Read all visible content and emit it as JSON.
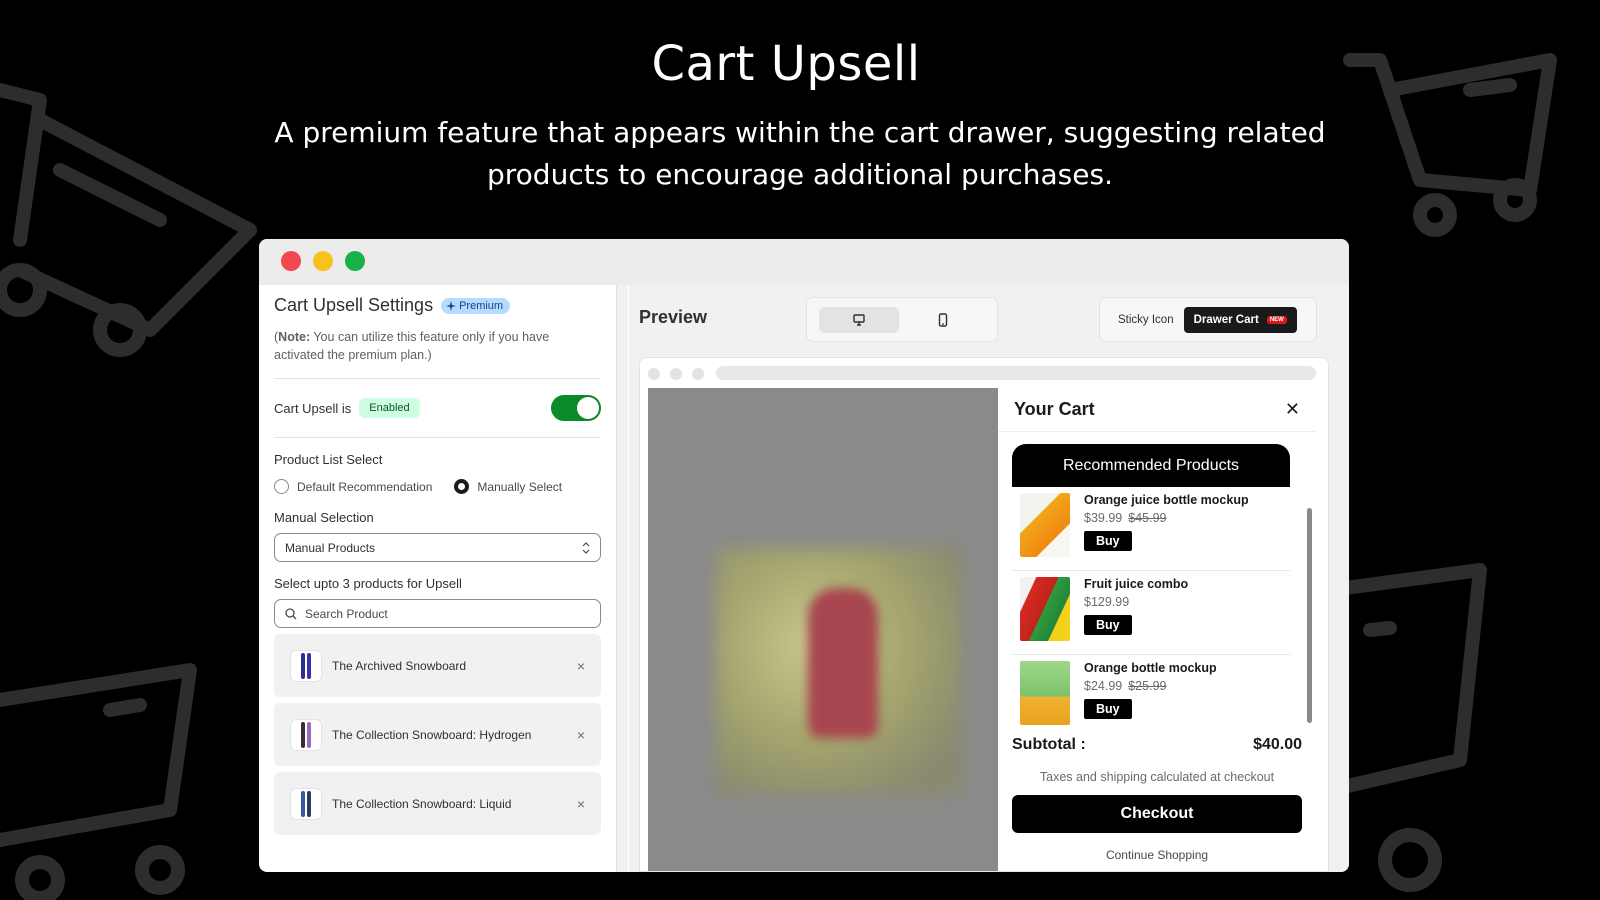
{
  "hero": {
    "title": "Cart Upsell",
    "subtitle": "A premium feature that appears within the cart drawer, suggesting related products to encourage additional purchases."
  },
  "settings": {
    "title": "Cart Upsell Settings",
    "premium_badge": "Premium",
    "note_bold": "Note:",
    "note_open": "(",
    "note_text": " You can utilize this feature only if you have activated the premium plan.)",
    "status_label": "Cart Upsell is",
    "status_badge": "Enabled",
    "toggle_on": true,
    "product_list_label": "Product List Select",
    "radio_default": "Default Recommendation",
    "radio_manual": "Manually Select",
    "manual_selection_label": "Manual Selection",
    "manual_select_value": "Manual Products",
    "upsell_label": "Select upto 3 products for Upsell",
    "search_placeholder": "Search Product",
    "products": [
      {
        "name": "The Archived Snowboard",
        "remove": "×"
      },
      {
        "name": "The Collection Snowboard: Hydrogen",
        "remove": "×"
      },
      {
        "name": "The Collection Snowboard: Liquid",
        "remove": "×"
      }
    ]
  },
  "preview": {
    "label": "Preview",
    "sticky_icon": "Sticky Icon",
    "drawer_cart": "Drawer Cart",
    "new_badge": "NEW"
  },
  "cart": {
    "title": "Your Cart",
    "close": "✕",
    "rec_title": "Recommended Products",
    "items": [
      {
        "name": "Orange juice bottle mockup",
        "price": "$39.99",
        "compare": "$45.99",
        "buy": "Buy"
      },
      {
        "name": "Fruit juice combo",
        "price": "$129.99",
        "compare": "",
        "buy": "Buy"
      },
      {
        "name": "Orange bottle mockup",
        "price": "$24.99",
        "compare": "$25.99",
        "buy": "Buy"
      }
    ],
    "subtotal_label": "Subtotal :",
    "subtotal_value": "$40.00",
    "taxes": "Taxes and shipping calculated at checkout",
    "checkout": "Checkout",
    "continue": "Continue Shopping"
  },
  "colors": {
    "toggle_on": "#0a8a2a",
    "premium_badge": "#b3dcff",
    "enabled_badge": "#cdfee1",
    "close_dot": "#f1494f",
    "minimize_dot": "#f6c31c",
    "maximize_dot": "#17b14a"
  }
}
